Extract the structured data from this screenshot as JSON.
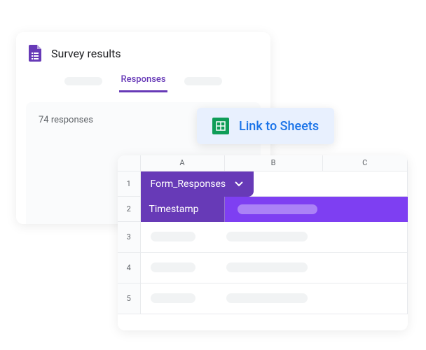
{
  "forms": {
    "title": "Survey results",
    "active_tab": "Responses",
    "response_count": "74 responses"
  },
  "link_button": {
    "label": "Link to Sheets"
  },
  "sheet": {
    "columns": [
      "A",
      "B",
      "C"
    ],
    "rows": [
      "1",
      "2",
      "3",
      "4",
      "5"
    ],
    "tab_name": "Form_Responses",
    "header_cell": "Timestamp"
  }
}
